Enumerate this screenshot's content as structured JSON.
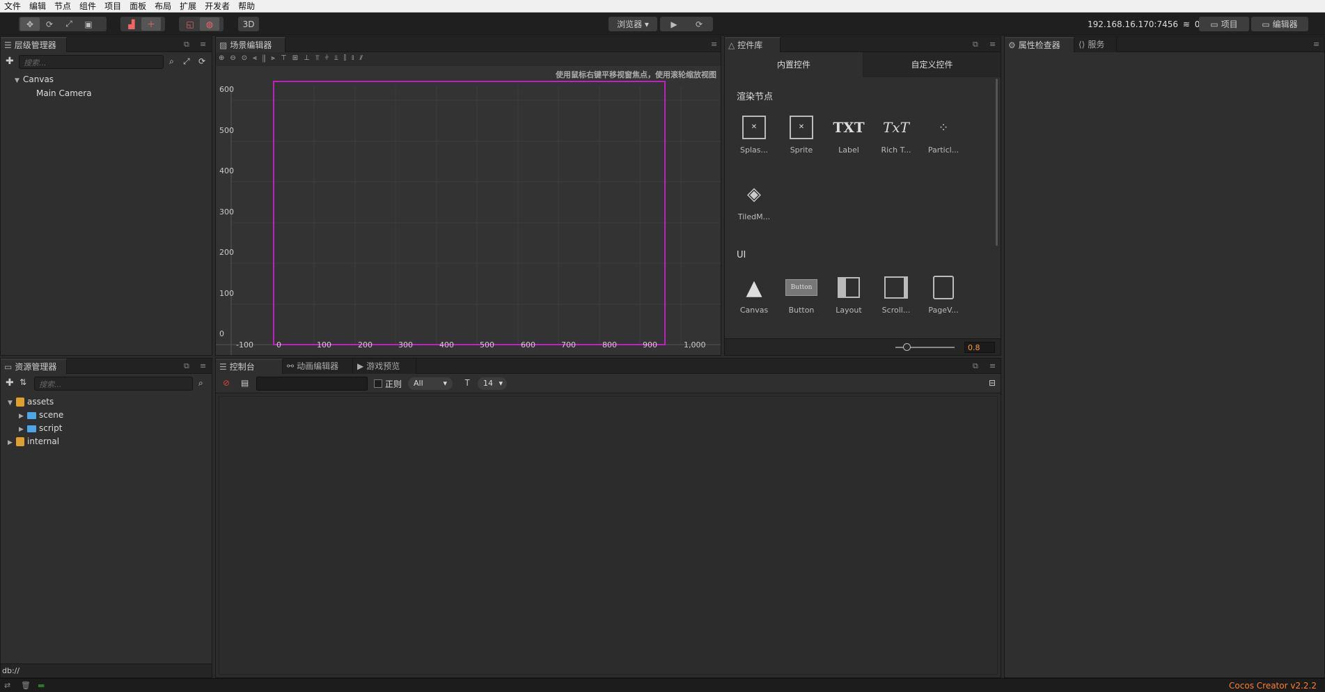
{
  "menu": [
    "文件",
    "编辑",
    "节点",
    "组件",
    "项目",
    "面板",
    "布局",
    "扩展",
    "开发者",
    "帮助"
  ],
  "toolbar": {
    "browser_label": "浏览器 ▾",
    "mode_3d": "3D",
    "ip_address": "192.168.16.170:7456",
    "connection_count": "0",
    "project_btn": "项目",
    "editor_btn": "编辑器"
  },
  "hierarchy": {
    "tab": "层级管理器",
    "search_placeholder": "搜索...",
    "nodes": [
      {
        "label": "Canvas"
      },
      {
        "label": "Main Camera"
      }
    ]
  },
  "scene": {
    "tab": "场景编辑器",
    "hint": "使用鼠标右键平移视窗焦点，使用滚轮缩放视图",
    "y_ticks": [
      "600",
      "500",
      "400",
      "300",
      "200",
      "100",
      "0"
    ],
    "x_ticks": [
      "-100",
      "0",
      "100",
      "200",
      "300",
      "400",
      "500",
      "600",
      "700",
      "800",
      "900",
      "1,000"
    ]
  },
  "widgets": {
    "tab": "控件库",
    "tab_builtin": "内置控件",
    "tab_custom": "自定义控件",
    "section_render": "渲染节点",
    "render_items": [
      "Splas...",
      "Sprite",
      "Label",
      "Rich T...",
      "Particl...",
      "TiledM..."
    ],
    "section_ui": "UI",
    "ui_items": [
      "Canvas",
      "Button",
      "Layout",
      "Scroll...",
      "PageV..."
    ],
    "button_icon_text": "Button",
    "label_icon_text": "TXT",
    "richtext_icon_text": "TxT",
    "zoom_value": "0.8"
  },
  "inspector": {
    "tab": "属性检查器",
    "service_tab": "服务"
  },
  "assets": {
    "tab": "资源管理器",
    "search_placeholder": "搜索...",
    "items": [
      {
        "label": "assets"
      },
      {
        "label": "scene"
      },
      {
        "label": "script"
      },
      {
        "label": "internal"
      }
    ],
    "footer": "db://"
  },
  "console": {
    "tab": "控制台",
    "anim_tab": "动画编辑器",
    "preview_tab": "游戏预览",
    "regex_label": "正则",
    "level_select": "All",
    "font_size": "14"
  },
  "status": {
    "version": "Cocos Creator v2.2.2"
  },
  "colors": {
    "accent": "#c020c0",
    "version_text": "#ff7f2a",
    "zoom_text": "#ff9a3a"
  }
}
